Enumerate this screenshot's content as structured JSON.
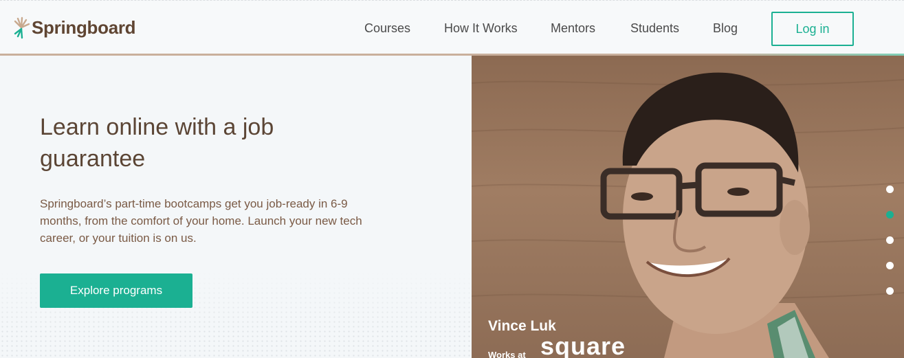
{
  "header": {
    "logo_text": "Springboard",
    "nav": [
      {
        "label": "Courses"
      },
      {
        "label": "How It Works"
      },
      {
        "label": "Mentors"
      },
      {
        "label": "Students"
      },
      {
        "label": "Blog"
      }
    ],
    "login_label": "Log in"
  },
  "hero": {
    "title": "Learn online with a job guarantee",
    "subtitle": "Springboard’s part-time bootcamps get you job-ready in 6-9 months, from the comfort of your home. Launch your new tech career, or your tuition is on us.",
    "cta_label": "Explore programs"
  },
  "testimonial": {
    "name": "Vince Luk",
    "works_at_label": "Works at",
    "company": "square"
  },
  "slider": {
    "count": 5,
    "active_index": 1
  },
  "colors": {
    "accent": "#1bb092",
    "brand_brown": "#5f4532",
    "text_brown": "#7a5a45"
  }
}
